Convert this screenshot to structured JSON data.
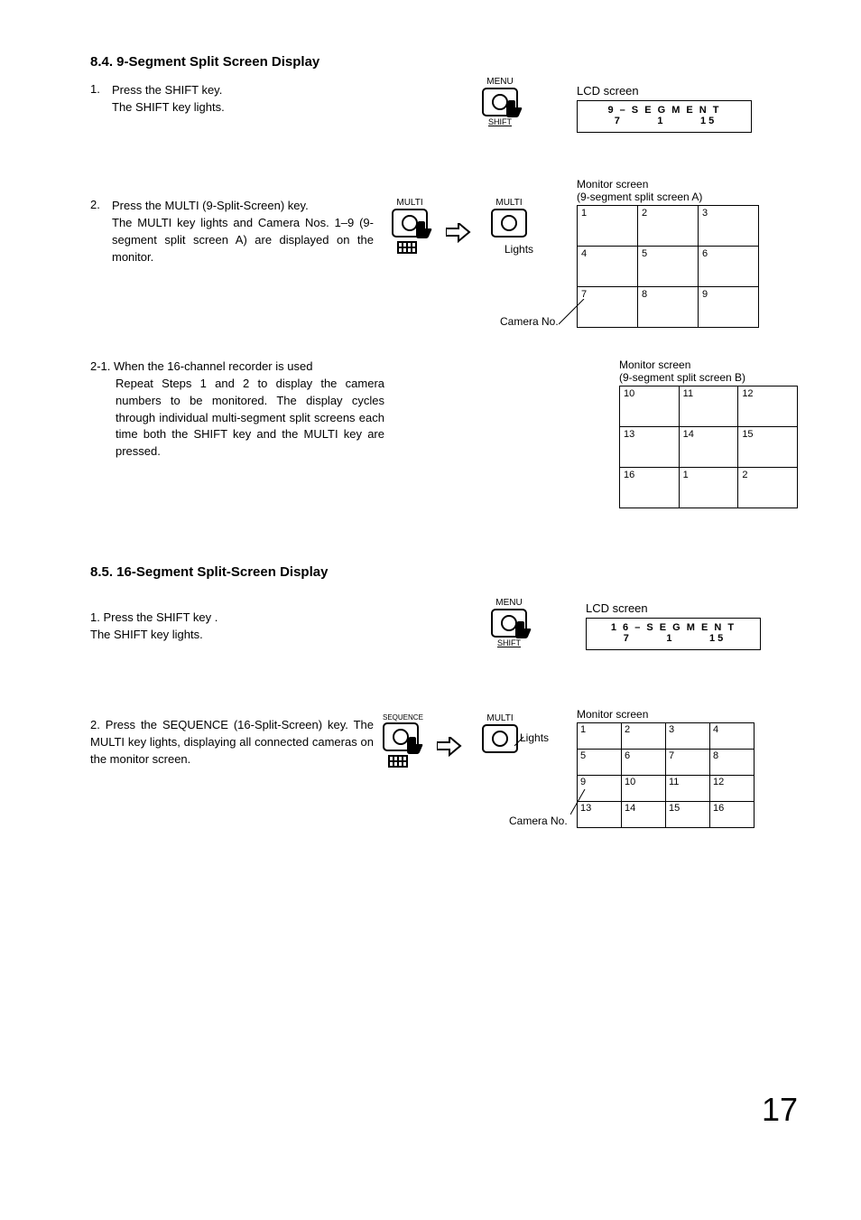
{
  "page_number": "17",
  "sec_84": {
    "heading": "8.4. 9-Segment Split Screen Display",
    "step1_num": "1.",
    "step1_body": "Press the SHIFT key.\nThe SHIFT key lights.",
    "lcd_label": "LCD screen",
    "lcd_line1": "9 – S E G M E N T",
    "lcd_r_a": "7",
    "lcd_r_b": "1",
    "lcd_r_c": "1 5",
    "key1_top": "MENU",
    "key1_bottom": "SHIFT",
    "step2_num": "2.",
    "step2_body": "Press the MULTI (9-Split-Screen) key.\nThe MULTI key lights and Camera Nos. 1–9 (9-segment split screen A) are displayed on the monitor.",
    "key2a_top": "MULTI",
    "key2b_top": "MULTI",
    "lights": "Lights",
    "mon_a_label1": "Monitor screen",
    "mon_a_label2": "(9-segment split screen A)",
    "gridA": [
      [
        "1",
        "2",
        "3"
      ],
      [
        "4",
        "5",
        "6"
      ],
      [
        "7",
        "8",
        "9"
      ]
    ],
    "camno": "Camera No.",
    "step21_num": "2-1.",
    "step21_head": "When the 16-channel recorder is used",
    "step21_body": "Repeat Steps 1 and 2 to display the camera numbers to be monitored. The display cycles through individual multi-segment split screens each time both the SHIFT key and the MULTI key are pressed.",
    "mon_b_label1": "Monitor screen",
    "mon_b_label2": "(9-segment split screen B)",
    "gridB": [
      [
        "10",
        "11",
        "12"
      ],
      [
        "13",
        "14",
        "15"
      ],
      [
        "16",
        "1",
        "2"
      ]
    ]
  },
  "sec_85": {
    "heading": "8.5. 16-Segment Split-Screen Display",
    "step1_num": "1.",
    "step1_body": "Press the SHIFT key .\nThe SHIFT key lights.",
    "lcd_label": "LCD screen",
    "lcd_line1": "1 6 – S E G M E N T",
    "lcd_r_a": "7",
    "lcd_r_b": "1",
    "lcd_r_c": "1 5",
    "key1_top": "MENU",
    "key1_bottom": "SHIFT",
    "step2_num": "2.",
    "step2_body": "Press the SEQUENCE (16-Split-Screen) key.\nThe MULTI key lights, displaying all connected cameras on the monitor screen.",
    "keyA_top": "SEQUENCE",
    "keyB_top": "MULTI",
    "lights": "Lights",
    "mon_label": "Monitor screen",
    "grid": [
      [
        "1",
        "2",
        "3",
        "4"
      ],
      [
        "5",
        "6",
        "7",
        "8"
      ],
      [
        "9",
        "10",
        "11",
        "12"
      ],
      [
        "13",
        "14",
        "15",
        "16"
      ]
    ],
    "camno": "Camera No."
  }
}
